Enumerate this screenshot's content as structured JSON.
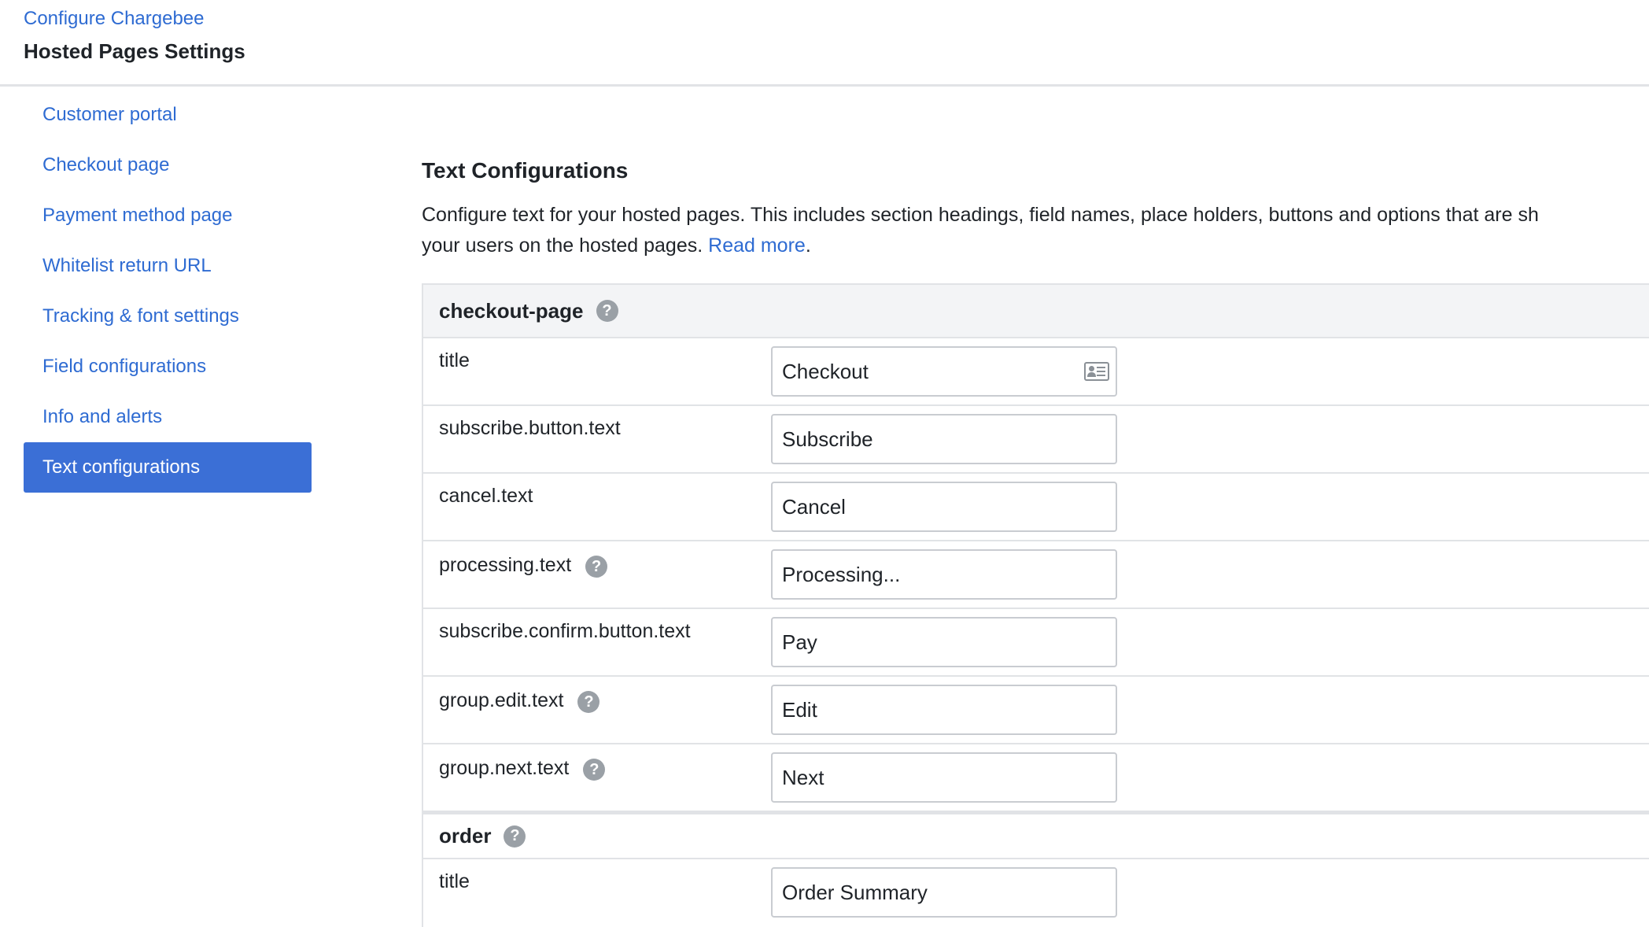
{
  "header": {
    "breadcrumb": "Configure Chargebee",
    "title": "Hosted Pages Settings"
  },
  "sidebar": {
    "items": [
      {
        "label": "Customer portal"
      },
      {
        "label": "Checkout page"
      },
      {
        "label": "Payment method page"
      },
      {
        "label": "Whitelist return URL"
      },
      {
        "label": "Tracking & font settings"
      },
      {
        "label": "Field configurations"
      },
      {
        "label": "Info and alerts"
      },
      {
        "label": "Text configurations"
      }
    ]
  },
  "main": {
    "title": "Text Configurations",
    "description_line1": "Configure text for your hosted pages. This includes section headings, field names, place holders, buttons and options that are sh",
    "description_line2": "your users on the hosted pages.",
    "read_more": "Read more",
    "period": "."
  },
  "groups": {
    "checkout": {
      "name": "checkout-page",
      "rows": [
        {
          "label": "title",
          "value": "Checkout"
        },
        {
          "label": "subscribe.button.text",
          "value": "Subscribe"
        },
        {
          "label": "cancel.text",
          "value": "Cancel"
        },
        {
          "label": "processing.text",
          "value": "Processing..."
        },
        {
          "label": "subscribe.confirm.button.text",
          "value": "Pay"
        },
        {
          "label": "group.edit.text",
          "value": "Edit"
        },
        {
          "label": "group.next.text",
          "value": "Next"
        }
      ]
    },
    "order": {
      "name": "order",
      "rows": [
        {
          "label": "title",
          "value": "Order Summary"
        }
      ]
    }
  },
  "icons": {
    "help": "question-circle-icon",
    "contact_card": "contact-card-icon"
  },
  "help_glyph": "?",
  "colors": {
    "link": "#2e6bd2",
    "active_bg": "#3b6fd6",
    "border": "#e1e3e6",
    "group_header_bg": "#f3f4f6",
    "help_icon": "#9aa0a6"
  }
}
